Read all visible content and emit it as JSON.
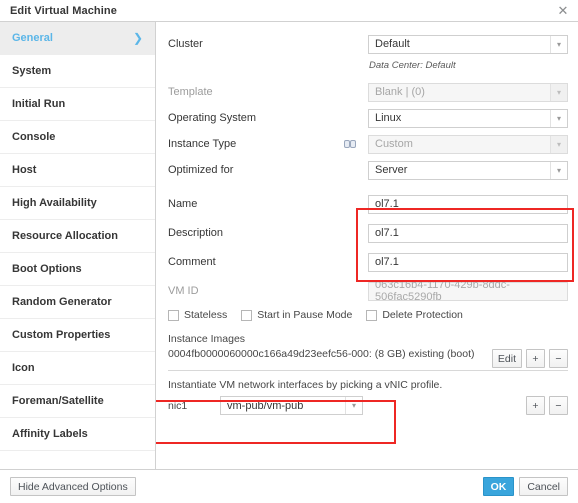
{
  "window": {
    "title": "Edit Virtual Machine",
    "close_icon": "close-icon",
    "close_glyph": "✕"
  },
  "sidebar": {
    "items": [
      {
        "label": "General",
        "active": true,
        "chevron": "❯"
      },
      {
        "label": "System",
        "active": false
      },
      {
        "label": "Initial Run",
        "active": false
      },
      {
        "label": "Console",
        "active": false
      },
      {
        "label": "Host",
        "active": false
      },
      {
        "label": "High Availability",
        "active": false
      },
      {
        "label": "Resource Allocation",
        "active": false
      },
      {
        "label": "Boot Options",
        "active": false
      },
      {
        "label": "Random Generator",
        "active": false
      },
      {
        "label": "Custom Properties",
        "active": false
      },
      {
        "label": "Icon",
        "active": false
      },
      {
        "label": "Foreman/Satellite",
        "active": false
      },
      {
        "label": "Affinity Labels",
        "active": false
      }
    ]
  },
  "form": {
    "cluster": {
      "label": "Cluster",
      "value": "Default",
      "disabled": false
    },
    "cluster_note": "Data Center: Default",
    "template": {
      "label": "Template",
      "value": "Blank | (0)",
      "disabled": true
    },
    "operating_system": {
      "label": "Operating System",
      "value": "Linux",
      "disabled": false
    },
    "instance_type": {
      "label": "Instance Type",
      "value": "Custom",
      "disabled": true,
      "icon": "chain-link-icon"
    },
    "optimized_for": {
      "label": "Optimized for",
      "value": "Server",
      "disabled": false
    },
    "name": {
      "label": "Name",
      "value": "ol7.1",
      "placeholder": ""
    },
    "description": {
      "label": "Description",
      "value": "ol7.1",
      "placeholder": ""
    },
    "comment": {
      "label": "Comment",
      "value": "ol7.1",
      "placeholder": ""
    },
    "vm_id": {
      "label": "VM ID",
      "value": "063c16b4-1170-429b-8ddc-506fac5290fb",
      "readonly": true
    },
    "checkboxes": [
      {
        "label": "Stateless",
        "checked": false
      },
      {
        "label": "Start in Pause Mode",
        "checked": false
      },
      {
        "label": "Delete Protection",
        "checked": false
      }
    ]
  },
  "instance_images": {
    "header": "Instance Images",
    "entry": "0004fb0000060000c166a49d23eefc56-000: (8 GB) existing (boot)",
    "buttons": {
      "edit": "Edit",
      "add": "+",
      "remove": "−"
    }
  },
  "nic_section": {
    "note": "Instantiate VM network interfaces by picking a vNIC profile.",
    "nic_label": "nic1",
    "nic_profile": "vm-pub/vm-pub",
    "buttons": {
      "add": "+",
      "remove": "−"
    }
  },
  "footer": {
    "hide_advanced": "Hide Advanced Options",
    "ok": "OK",
    "cancel": "Cancel"
  },
  "colors": {
    "accent": "#5bb6e8",
    "primary_button": "#39a5dc",
    "highlight_box": "#ee2724"
  },
  "caret_glyph": "▾"
}
